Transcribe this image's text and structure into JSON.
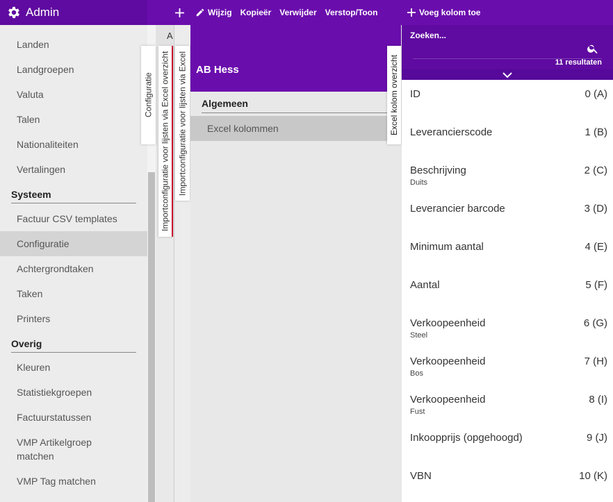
{
  "topbar": {
    "app_title": "Admin",
    "actions": [
      "Wijzig",
      "Kopieër",
      "Verwijder",
      "Verstop/Toon"
    ],
    "add_column": "Voeg kolom toe"
  },
  "sidebar": {
    "items_top": [
      "Landen",
      "Landgroepen",
      "Valuta",
      "Talen",
      "Nationaliteiten",
      "Vertalingen"
    ],
    "section_system": "Systeem",
    "items_system": [
      "Factuur CSV templates",
      "Configuratie",
      "Achtergrondtaken",
      "Taken",
      "Printers"
    ],
    "section_other": "Overig",
    "items_other": [
      "Kleuren",
      "Statistiekgroepen",
      "Factuurstatussen",
      "VMP Artikelgroep matchen",
      "VMP Tag matchen"
    ]
  },
  "panels": {
    "panelA_header": "A",
    "tab_config": "Configuratie",
    "tab_import_overview": "Importconfiguratie voor lijsten via Excel overzicht",
    "tab_import": "Importconfiguratie voor lijsten via Excel",
    "tab_excel_overview": "Excel kolom overzicht"
  },
  "detail": {
    "title": "AB Hess",
    "section": "Algemeen",
    "row": "Excel kolommen"
  },
  "list": {
    "search_label": "Zoeken...",
    "results": "11 resultaten",
    "items": [
      {
        "name": "ID",
        "value": "0 (A)",
        "sub": ""
      },
      {
        "name": "Leverancierscode",
        "value": "1 (B)",
        "sub": ""
      },
      {
        "name": "Beschrijving",
        "value": "2 (C)",
        "sub": "Duits"
      },
      {
        "name": "Leverancier barcode",
        "value": "3 (D)",
        "sub": ""
      },
      {
        "name": "Minimum aantal",
        "value": "4 (E)",
        "sub": ""
      },
      {
        "name": "Aantal",
        "value": "5 (F)",
        "sub": ""
      },
      {
        "name": "Verkoopeenheid",
        "value": "6 (G)",
        "sub": "Steel"
      },
      {
        "name": "Verkoopeenheid",
        "value": "7 (H)",
        "sub": "Bos"
      },
      {
        "name": "Verkoopeenheid",
        "value": "8 (I)",
        "sub": "Fust"
      },
      {
        "name": "Inkoopprijs (opgehoogd)",
        "value": "9 (J)",
        "sub": ""
      },
      {
        "name": "VBN",
        "value": "10 (K)",
        "sub": ""
      }
    ]
  },
  "colors": {
    "primary": "#6a0dad",
    "primary_dark": "#5f0aa0"
  }
}
